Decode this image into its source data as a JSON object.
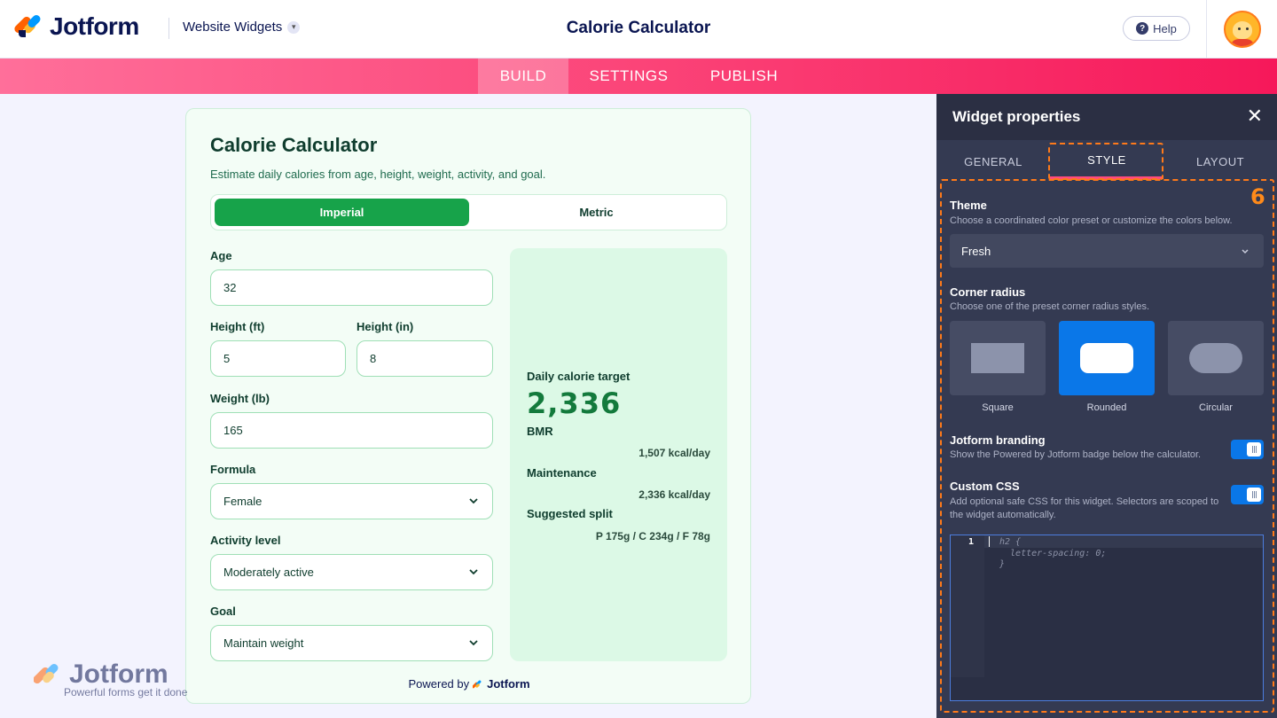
{
  "header": {
    "brand": "Jotform",
    "product": "Website Widgets",
    "title": "Calorie Calculator",
    "help_label": "Help"
  },
  "nav": {
    "tabs": [
      {
        "label": "BUILD",
        "active": true
      },
      {
        "label": "SETTINGS",
        "active": false
      },
      {
        "label": "PUBLISH",
        "active": false
      }
    ]
  },
  "calculator": {
    "title": "Calorie Calculator",
    "subtitle": "Estimate daily calories from age, height, weight, activity, and goal.",
    "units": {
      "imperial": "Imperial",
      "metric": "Metric",
      "selected": "Imperial"
    },
    "fields": {
      "age": {
        "label": "Age",
        "value": "32"
      },
      "height_ft": {
        "label": "Height (ft)",
        "value": "5"
      },
      "height_in": {
        "label": "Height (in)",
        "value": "8"
      },
      "weight": {
        "label": "Weight (lb)",
        "value": "165"
      },
      "formula": {
        "label": "Formula",
        "value": "Female"
      },
      "activity": {
        "label": "Activity level",
        "value": "Moderately active"
      },
      "goal": {
        "label": "Goal",
        "value": "Maintain weight"
      }
    },
    "result": {
      "target_label": "Daily calorie target",
      "target_value": "2,336",
      "bmr_label": "BMR",
      "bmr_value": "1,507 kcal/day",
      "maintenance_label": "Maintenance",
      "maintenance_value": "2,336 kcal/day",
      "split_label": "Suggested split",
      "split_value": "P 175g / C 234g / F 78g"
    },
    "powered_prefix": "Powered by",
    "powered_brand": "Jotform"
  },
  "watermark": {
    "brand": "Jotform",
    "tagline": "Powerful forms get it done"
  },
  "panel": {
    "title": "Widget properties",
    "tabs": [
      {
        "label": "GENERAL",
        "active": false
      },
      {
        "label": "STYLE",
        "active": true
      },
      {
        "label": "LAYOUT",
        "active": false
      }
    ],
    "step": "6",
    "theme": {
      "title": "Theme",
      "desc": "Choose a coordinated color preset or customize the colors below.",
      "value": "Fresh"
    },
    "corner_radius": {
      "title": "Corner radius",
      "desc": "Choose one of the preset corner radius styles.",
      "options": [
        "Square",
        "Rounded",
        "Circular"
      ],
      "selected": "Rounded"
    },
    "branding": {
      "title": "Jotform branding",
      "desc": "Show the Powered by Jotform badge below the calculator.",
      "on": true
    },
    "custom_css": {
      "title": "Custom CSS",
      "desc": "Add optional safe CSS for this widget. Selectors are scoped to the widget automatically.",
      "on": true,
      "line_number": "1",
      "code_lines": [
        "h2 {",
        "  letter-spacing: 0;",
        "}"
      ]
    }
  },
  "colors": {
    "nav_pink": "#fb4478",
    "primary_green": "#17a34a",
    "panel_bg": "#343a52",
    "accent_blue": "#0a77e8",
    "highlight_orange": "#ff7a1a"
  }
}
